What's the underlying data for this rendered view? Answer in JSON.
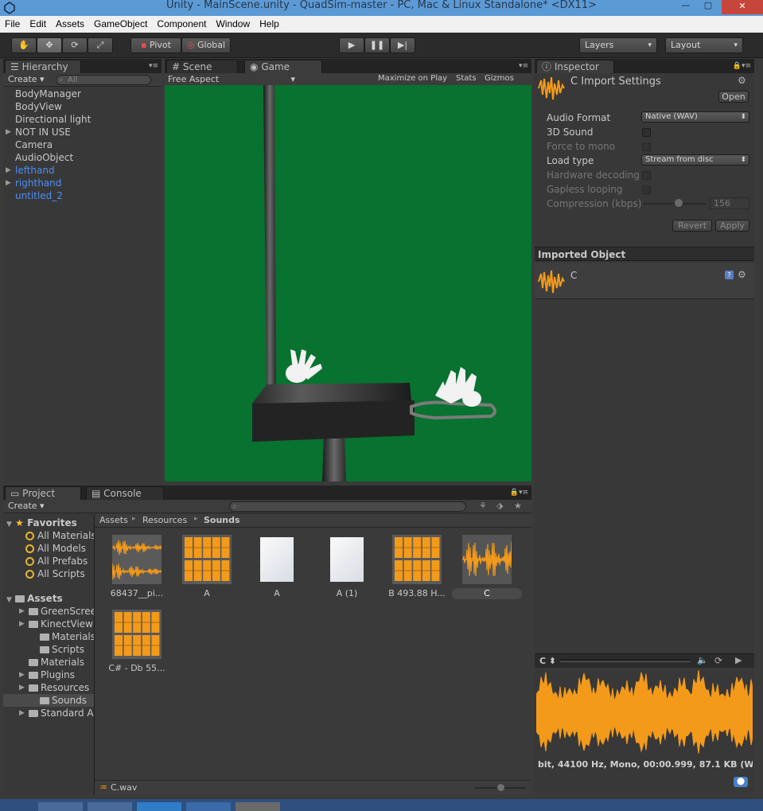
{
  "window": {
    "title": "Unity - MainScene.unity - QuadSim-master - PC, Mac & Linux Standalone* <DX11>",
    "minimize": "—",
    "maximize": "▢",
    "close": "✕"
  },
  "menu": [
    "File",
    "Edit",
    "Assets",
    "GameObject",
    "Component",
    "Window",
    "Help"
  ],
  "toolbar": {
    "pivot": "Pivot",
    "global": "Global",
    "layers": "Layers",
    "layout": "Layout"
  },
  "hierarchy": {
    "tab": "Hierarchy",
    "create": "Create ▾",
    "search_placeholder": "All",
    "items": [
      {
        "label": "BodyManager",
        "blue": false,
        "expandable": false
      },
      {
        "label": "BodyView",
        "blue": false,
        "expandable": false
      },
      {
        "label": "Directional light",
        "blue": false,
        "expandable": false
      },
      {
        "label": "NOT IN USE",
        "blue": false,
        "expandable": true
      },
      {
        "label": "Camera",
        "blue": false,
        "expandable": false
      },
      {
        "label": "AudioObject",
        "blue": false,
        "expandable": false
      },
      {
        "label": "lefthand",
        "blue": true,
        "expandable": true
      },
      {
        "label": "righthand",
        "blue": true,
        "expandable": true
      },
      {
        "label": "untitled_2",
        "blue": true,
        "expandable": false
      }
    ]
  },
  "scene_tabs": {
    "scene": "Scene",
    "game": "Game"
  },
  "game_bar": {
    "aspect": "Free Aspect",
    "maximize": "Maximize on Play",
    "stats": "Stats",
    "gizmos": "Gizmos"
  },
  "inspector": {
    "tab": "Inspector",
    "title": "C Import Settings",
    "open_button": "Open",
    "audio_format_label": "Audio Format",
    "audio_format_value": "Native (WAV)",
    "sound3d_label": "3D Sound",
    "force_mono_label": "Force to mono",
    "load_type_label": "Load type",
    "load_type_value": "Stream from disc",
    "hw_decoding_label": "Hardware decoding",
    "gapless_label": "Gapless looping",
    "compression_label": "Compression (kbps)",
    "compression_value": "156",
    "revert_button": "Revert",
    "apply_button": "Apply",
    "imported_object_header": "Imported Object",
    "imported_object_name": "C",
    "preview_name": "C",
    "preview_info": "bit, 44100 Hz, Mono, 00:00.999, 87.1 KB (W"
  },
  "project": {
    "tab": "Project",
    "console_tab": "Console",
    "create": "Create ▾",
    "breadcrumb": {
      "assets": "Assets",
      "resources": "Resources",
      "sounds": "Sounds"
    },
    "favorites_label": "Favorites",
    "favorites": [
      "All Materials",
      "All Models",
      "All Prefabs",
      "All Scripts"
    ],
    "assets_label": "Assets",
    "tree": [
      {
        "label": "GreenScree",
        "indent": 1,
        "arrow": true
      },
      {
        "label": "KinectView",
        "indent": 1,
        "arrow": true
      },
      {
        "label": "Materials",
        "indent": 2,
        "arrow": false
      },
      {
        "label": "Scripts",
        "indent": 2,
        "arrow": false
      },
      {
        "label": "Materials",
        "indent": 1,
        "arrow": false
      },
      {
        "label": "Plugins",
        "indent": 1,
        "arrow": true
      },
      {
        "label": "Resources",
        "indent": 1,
        "arrow": true
      },
      {
        "label": "Sounds",
        "indent": 2,
        "arrow": false
      },
      {
        "label": "Standard As",
        "indent": 1,
        "arrow": true
      }
    ],
    "assets": [
      {
        "label": "68437__pi...",
        "kind": "wave2"
      },
      {
        "label": "A",
        "kind": "grid"
      },
      {
        "label": "A",
        "kind": "doc"
      },
      {
        "label": "A (1)",
        "kind": "doc"
      },
      {
        "label": "B 493.88 H...",
        "kind": "grid"
      },
      {
        "label": "C",
        "kind": "wavebig"
      },
      {
        "label": "C# - Db 55...",
        "kind": "grid"
      }
    ],
    "status_file": "C.wav"
  },
  "colors": {
    "accent_orange": "#f39a1a",
    "game_bg": "#087230",
    "title_bar": "#5c9ad6",
    "selection_blue": "#4d8ef5"
  }
}
